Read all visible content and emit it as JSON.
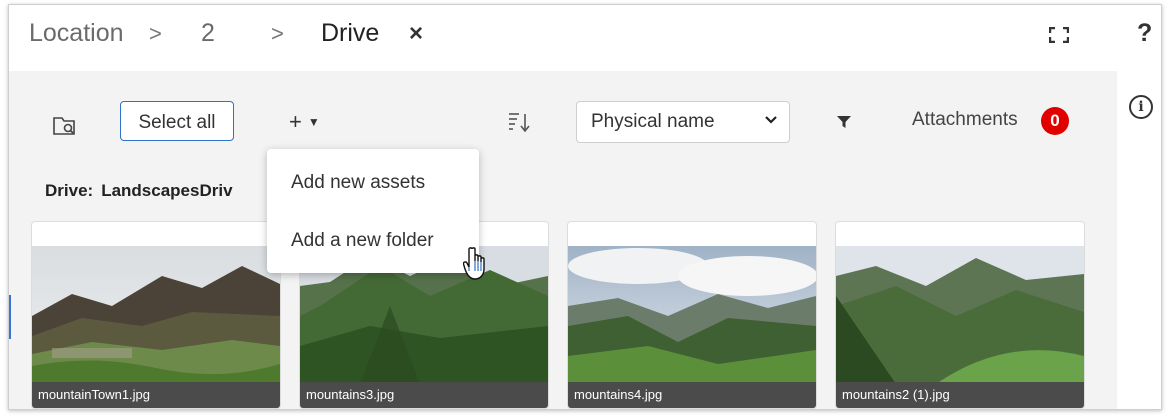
{
  "breadcrumb": {
    "items": [
      "Location",
      "2",
      "Drive"
    ],
    "separator": ">"
  },
  "header": {
    "close_icon": "×",
    "help_icon": "?"
  },
  "toolbar": {
    "select_all_label": "Select all",
    "add_label": "+",
    "sort_selected": "Physical name",
    "attachments_label": "Attachments",
    "attachments_count": "0"
  },
  "drive": {
    "label": "Drive:",
    "name": "LandscapesDriv"
  },
  "menu": {
    "items": [
      "Add new assets",
      "Add a new folder"
    ]
  },
  "thumbnails": [
    {
      "filename": "mountainTown1.jpg"
    },
    {
      "filename": "mountains3.jpg"
    },
    {
      "filename": "mountains4.jpg"
    },
    {
      "filename": "mountains2 (1).jpg"
    }
  ],
  "colors": {
    "accent": "#2f73c9",
    "badge": "#e00000",
    "panel_bg": "#f3f3f3",
    "caption_bg": "#4b4b4b"
  },
  "icons": [
    "folder-search-icon",
    "sort-icon",
    "filter-icon",
    "expand-icon",
    "info-icon",
    "hand-cursor-icon",
    "close-icon",
    "help-icon",
    "chevron-down-icon"
  ]
}
